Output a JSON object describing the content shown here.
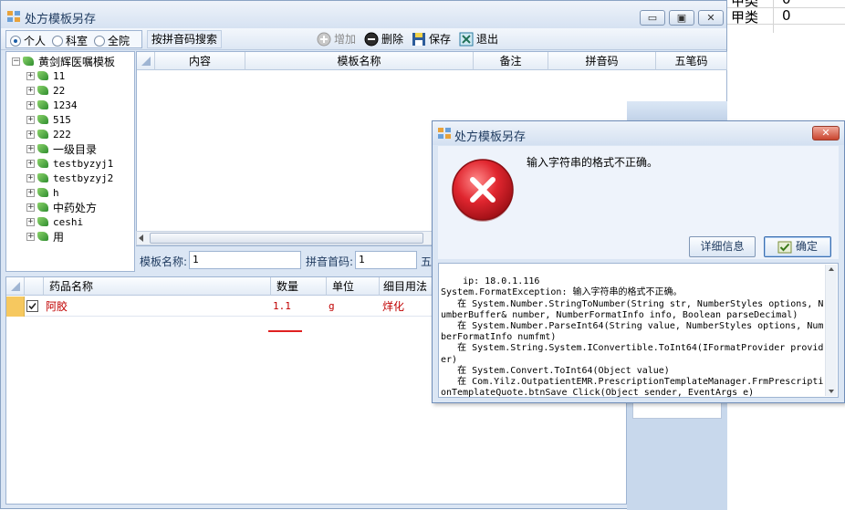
{
  "background_window": {
    "rows": [
      {
        "col1": "甲类",
        "col2": "0"
      },
      {
        "col1": "甲类",
        "col2": "0"
      }
    ]
  },
  "main_window": {
    "title": "处方模板另存",
    "controls": {
      "minimize": "▭",
      "restore": "▣",
      "close": "✕"
    },
    "scope": {
      "options": [
        "个人",
        "科室",
        "全院"
      ],
      "selected": "个人"
    },
    "search_button": "按拼音码搜索",
    "toolbar": {
      "add": "增加",
      "delete": "删除",
      "save": "保存",
      "exit": "退出"
    },
    "tree": {
      "root": "黄剑辉医嘱模板",
      "items": [
        "11",
        "22",
        "1234",
        "515",
        "222",
        "一级目录",
        "testbyzyj1",
        "testbyzyj2",
        "h",
        "中药处方",
        "ceshi",
        "用"
      ]
    },
    "template_grid": {
      "columns": [
        "内容",
        "模板名称",
        "备注",
        "拼音码",
        "五笔码"
      ]
    },
    "template_form": {
      "name_label": "模板名称:",
      "name_value": "1",
      "pinyin_label": "拼音首码:",
      "pinyin_value": "1",
      "wubi_label_partial": "五"
    },
    "drug_grid": {
      "columns": [
        "药品名称",
        "数量",
        "单位",
        "细目用法"
      ],
      "rows": [
        {
          "name": "阿胶",
          "qty": "1.1",
          "unit": "g",
          "usage": "烊化",
          "checked": true
        }
      ]
    }
  },
  "dialog": {
    "title": "处方模板另存",
    "message": "输入字符串的格式不正确。",
    "details_button": "详细信息",
    "ok_button": "确定",
    "details_text": "ip: 18.0.1.116\nSystem.FormatException: 输入字符串的格式不正确。\n   在 System.Number.StringToNumber(String str, NumberStyles options, NumberBuffer& number, NumberFormatInfo info, Boolean parseDecimal)\n   在 System.Number.ParseInt64(String value, NumberStyles options, NumberFormatInfo numfmt)\n   在 System.String.System.IConvertible.ToInt64(IFormatProvider provider)\n   在 System.Convert.ToInt64(Object value)\n   在 Com.Yilz.OutpatientEMR.PrescriptionTemplateManager.FrmPrescriptionTemplateQuote.btnSave_Click(Object sender, EventArgs e)"
  },
  "colors": {
    "error_red": "#d9232b",
    "row_text_red": "#c00000",
    "annotation_red": "#e02020"
  }
}
